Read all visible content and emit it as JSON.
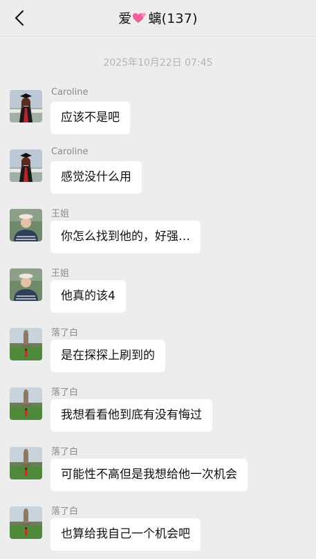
{
  "header": {
    "title_left": "爱",
    "title_right": "螭(137)"
  },
  "timestamp": "2025年10月22日 07:45",
  "messages": [
    {
      "sender": "Caroline",
      "text": "应该不是吧"
    },
    {
      "sender": "Caroline",
      "text": "感觉没什么用"
    },
    {
      "sender": "王姐",
      "text": "你怎么找到他的，好强…"
    },
    {
      "sender": "王姐",
      "text": "他真的该4"
    },
    {
      "sender": "落了白",
      "text": "是在探探上刷到的"
    },
    {
      "sender": "落了白",
      "text": "我想看看他到底有没有悔过"
    },
    {
      "sender": "落了白",
      "text": "可能性不高但是我想给他一次机会"
    },
    {
      "sender": "落了白",
      "text": "也算给我自己一个机会吧"
    }
  ]
}
